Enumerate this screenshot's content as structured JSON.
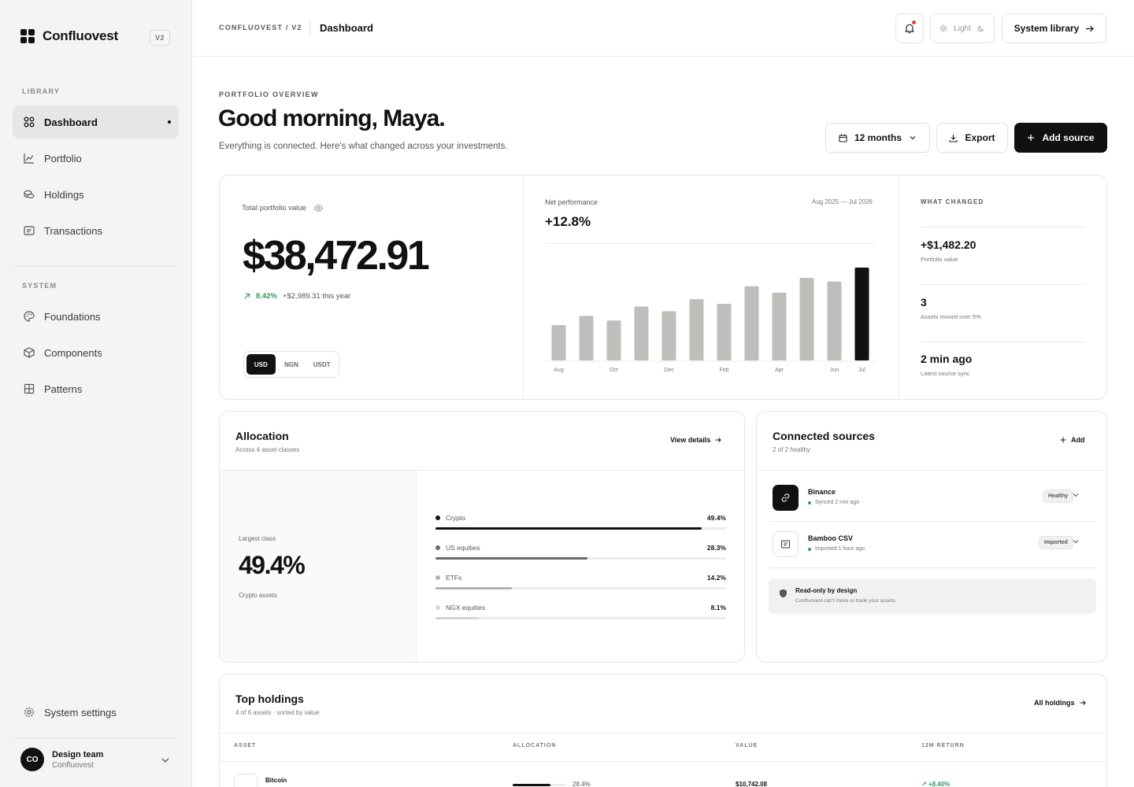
{
  "brand": {
    "name": "Confluovest",
    "version": "V2"
  },
  "sidebar": {
    "library_title": "LIBRARY",
    "library_items": [
      {
        "label": "Dashboard",
        "icon": "grid-icon",
        "active": true
      },
      {
        "label": "Portfolio",
        "icon": "chart-line-icon",
        "active": false
      },
      {
        "label": "Holdings",
        "icon": "coins-icon",
        "active": false
      },
      {
        "label": "Transactions",
        "icon": "receipt-icon",
        "active": false
      }
    ],
    "system_title": "SYSTEM",
    "system_items": [
      {
        "label": "Foundations",
        "icon": "palette-icon"
      },
      {
        "label": "Components",
        "icon": "cube-icon"
      },
      {
        "label": "Patterns",
        "icon": "layout-grid-icon"
      }
    ],
    "settings_label": "System settings",
    "team": {
      "initials": "CO",
      "name": "Design team",
      "org": "Confluovest"
    }
  },
  "topbar": {
    "breadcrumb": "CONFLUOVEST / V2",
    "page": "Dashboard",
    "theme_label": "Light",
    "library_button": "System library"
  },
  "header": {
    "eyebrow": "PORTFOLIO OVERVIEW",
    "greeting": "Good morning, Maya.",
    "subtitle": "Everything is connected. Here's what changed across your investments.",
    "range_button": "12 months",
    "export_button": "Export",
    "add_button": "Add source"
  },
  "portfolio": {
    "label": "Total portfolio value",
    "value": "$38,472.91",
    "change_pct": "8.42%",
    "change_text": "+$2,989.31 this year",
    "currencies": [
      "USD",
      "NGN",
      "USDT"
    ],
    "active_currency": "USD"
  },
  "performance": {
    "label": "Net performance",
    "value": "+12.8%",
    "range": "Aug 2025 — Jul 2026"
  },
  "chart_data": {
    "type": "bar",
    "categories": [
      "Aug",
      "Sep",
      "Oct",
      "Nov",
      "Dec",
      "Jan",
      "Feb",
      "Mar",
      "Apr",
      "May",
      "Jun",
      "Jul"
    ],
    "tick_labels": [
      "Aug",
      "",
      "Oct",
      "",
      "Dec",
      "",
      "Feb",
      "",
      "Apr",
      "",
      "Jun",
      "Jul"
    ],
    "values": [
      38,
      48,
      43,
      58,
      53,
      66,
      61,
      80,
      73,
      89,
      85,
      100
    ],
    "highlight_last": true,
    "bar_color": "#bebebb",
    "highlight_color": "#111111",
    "grid": false,
    "ylim": [
      0,
      100
    ]
  },
  "what_changed": {
    "title": "WHAT CHANGED",
    "items": [
      {
        "value": "+$1,482.20",
        "label": "Portfolio value"
      },
      {
        "value": "3",
        "label": "Assets moved over 5%"
      },
      {
        "value": "2 min ago",
        "label": "Latest source sync"
      }
    ]
  },
  "allocation": {
    "title": "Allocation",
    "subtitle": "Across 4 asset classes",
    "link": "View details",
    "largest_label": "Largest class",
    "largest_value": "49.4%",
    "largest_sub": "Crypto assets",
    "rows": [
      {
        "name": "Crypto",
        "pct": "49.4%",
        "fraction": 0.494,
        "color": "#111111"
      },
      {
        "name": "US equities",
        "pct": "28.3%",
        "fraction": 0.283,
        "color": "#6b6b6a"
      },
      {
        "name": "ETFs",
        "pct": "14.2%",
        "fraction": 0.142,
        "color": "#b3b3b1"
      },
      {
        "name": "NGX equities",
        "pct": "8.1%",
        "fraction": 0.081,
        "color": "#d4d4d2"
      }
    ]
  },
  "sources": {
    "title": "Connected sources",
    "subtitle": "2 of 2 healthy",
    "add_label": "Add",
    "items": [
      {
        "name": "Binance",
        "meta": "Synced 2 min ago",
        "badge": "Healthy",
        "icon": "link-icon"
      },
      {
        "name": "Bamboo CSV",
        "meta": "Imported 1 hour ago",
        "badge": "Imported",
        "icon": "document-icon"
      }
    ],
    "note_title": "Read-only by design",
    "note_text": "Confluovest can't move or trade your assets."
  },
  "holdings": {
    "title": "Top holdings",
    "subtitle": "4 of 6 assets · sorted by value",
    "link": "All holdings",
    "columns": [
      "ASSET",
      "ALLOCATION",
      "VALUE",
      "12M RETURN"
    ],
    "rows": [
      {
        "asset": "Bitcoin",
        "allocation": "28.4%",
        "fraction": 0.284,
        "value": "$10,742.08",
        "return": "+8.40%"
      }
    ]
  },
  "colors": {
    "accent": "#111111",
    "positive": "#2e9a5a",
    "notification": "#e0453a"
  }
}
